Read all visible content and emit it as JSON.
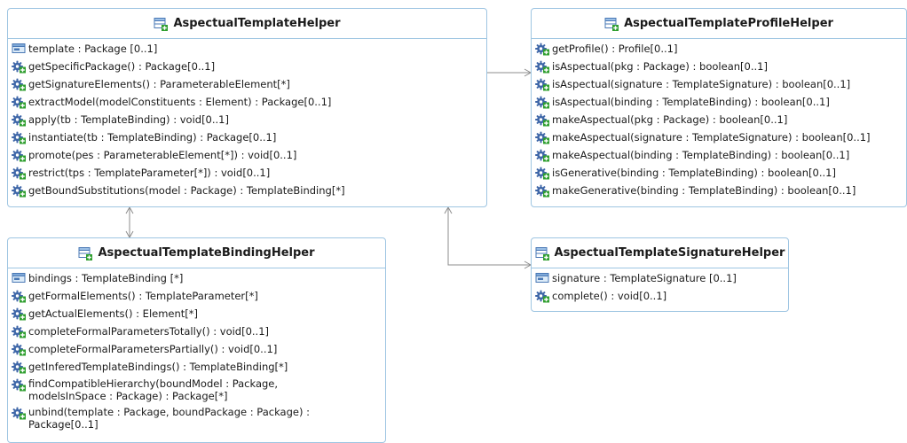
{
  "classes": {
    "template_helper": {
      "name": "AspectualTemplateHelper",
      "members": [
        {
          "kind": "attribute",
          "text": "template : Package [0..1]"
        },
        {
          "kind": "operation",
          "text": "getSpecificPackage() : Package[0..1]"
        },
        {
          "kind": "operation",
          "text": "getSignatureElements() : ParameterableElement[*]"
        },
        {
          "kind": "operation",
          "text": "extractModel(modelConstituents : Element) : Package[0..1]"
        },
        {
          "kind": "operation",
          "text": "apply(tb : TemplateBinding) : void[0..1]"
        },
        {
          "kind": "operation",
          "text": "instantiate(tb : TemplateBinding) : Package[0..1]"
        },
        {
          "kind": "operation",
          "text": "promote(pes : ParameterableElement[*]) : void[0..1]"
        },
        {
          "kind": "operation",
          "text": "restrict(tps : TemplateParameter[*]) : void[0..1]"
        },
        {
          "kind": "operation",
          "text": "getBoundSubstitutions(model : Package) : TemplateBinding[*]"
        }
      ]
    },
    "profile_helper": {
      "name": "AspectualTemplateProfileHelper",
      "members": [
        {
          "kind": "operation",
          "text": "getProfile() : Profile[0..1]"
        },
        {
          "kind": "operation",
          "text": "isAspectual(pkg : Package) : boolean[0..1]"
        },
        {
          "kind": "operation",
          "text": "isAspectual(signature : TemplateSignature) : boolean[0..1]"
        },
        {
          "kind": "operation",
          "text": "isAspectual(binding : TemplateBinding) : boolean[0..1]"
        },
        {
          "kind": "operation",
          "text": "makeAspectual(pkg : Package) : boolean[0..1]"
        },
        {
          "kind": "operation",
          "text": "makeAspectual(signature : TemplateSignature) : boolean[0..1]"
        },
        {
          "kind": "operation",
          "text": "makeAspectual(binding : TemplateBinding) : boolean[0..1]"
        },
        {
          "kind": "operation",
          "text": "isGenerative(binding : TemplateBinding) : boolean[0..1]"
        },
        {
          "kind": "operation",
          "text": "makeGenerative(binding : TemplateBinding) : boolean[0..1]"
        }
      ]
    },
    "binding_helper": {
      "name": "AspectualTemplateBindingHelper",
      "members": [
        {
          "kind": "attribute",
          "text": "bindings : TemplateBinding [*]"
        },
        {
          "kind": "operation",
          "text": "getFormalElements() : TemplateParameter[*]"
        },
        {
          "kind": "operation",
          "text": "getActualElements() : Element[*]"
        },
        {
          "kind": "operation",
          "text": "completeFormalParametersTotally() : void[0..1]"
        },
        {
          "kind": "operation",
          "text": "completeFormalParametersPartially() : void[0..1]"
        },
        {
          "kind": "operation",
          "text": "getInferedTemplateBindings() : TemplateBinding[*]"
        },
        {
          "kind": "operation",
          "text": "findCompatibleHierarchy(boundModel : Package, modelsInSpace : Package) : Package[*]"
        },
        {
          "kind": "operation",
          "text": "unbind(template : Package, boundPackage : Package) : Package[0..1]"
        }
      ]
    },
    "signature_helper": {
      "name": "AspectualTemplateSignatureHelper",
      "members": [
        {
          "kind": "attribute",
          "text": "signature : TemplateSignature [0..1]"
        },
        {
          "kind": "operation",
          "text": "complete() : void[0..1]"
        }
      ]
    }
  },
  "icons": {
    "class": "class-icon",
    "attribute": "attribute-icon",
    "operation": "operation-gear-icon"
  },
  "colors": {
    "border": "#9ec5e2",
    "edge": "#8c8c8c",
    "gear": "#3f67a8",
    "plus": "#2e9e2e"
  }
}
